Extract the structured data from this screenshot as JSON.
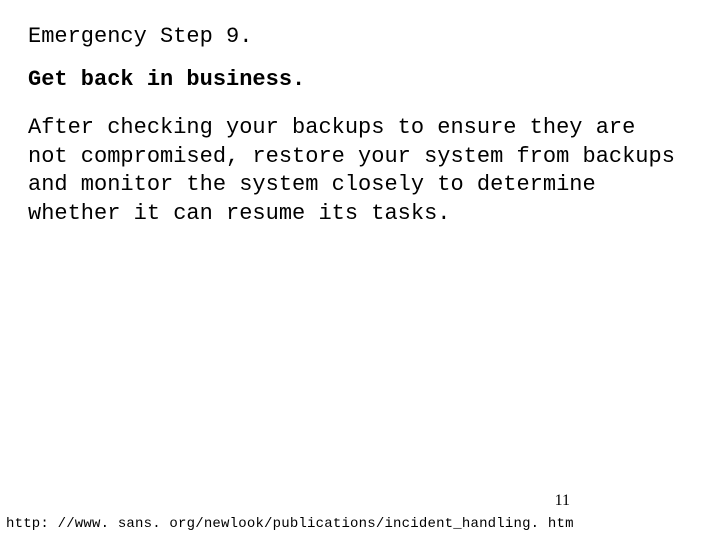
{
  "step_label": "Emergency Step 9.",
  "headline": "Get back in business.",
  "body": "After checking your backups to ensure they are not compromised, restore your system from backups and monitor the system closely to determine whether it can resume its tasks.",
  "page_number": "11",
  "footer_url": "http: //www. sans. org/newlook/publications/incident_handling. htm"
}
